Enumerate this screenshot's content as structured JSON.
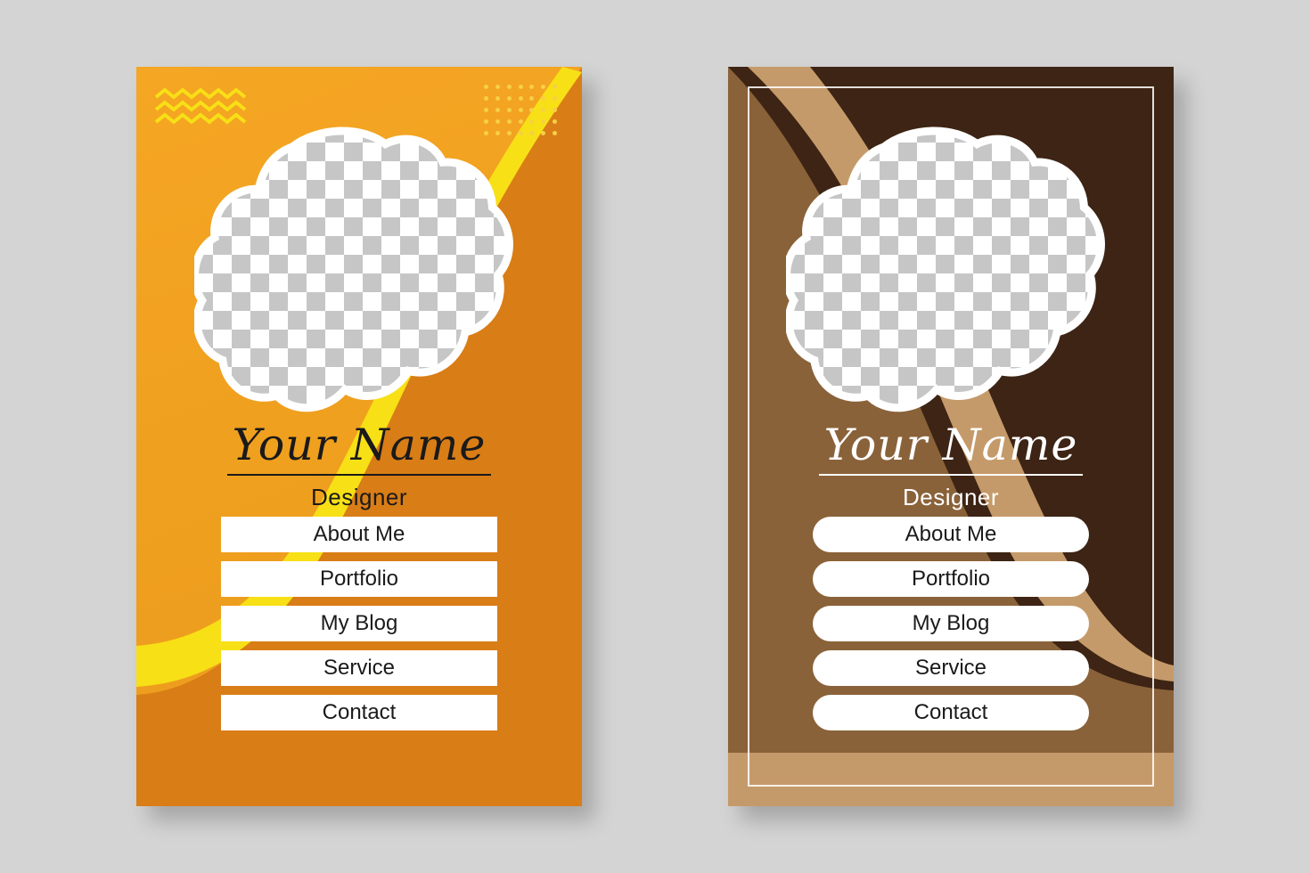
{
  "page": {
    "background_color": "#d4d4d4",
    "card_count": 2
  },
  "cards": [
    {
      "id": "card-orange",
      "theme": "orange",
      "colors": {
        "bg_light": "#f5a623",
        "bg_dark": "#d97d16",
        "accent_yellow": "#f7e016",
        "dots": "#f7d046",
        "text": "#1a1a1a",
        "button_bg": "#ffffff"
      },
      "decorations": [
        "zigzag-lines",
        "dot-grid",
        "yellow-wave",
        "dark-orange-curve"
      ],
      "photo": {
        "label": "photo-placeholder",
        "shape": "blob",
        "fill": "checkerboard"
      },
      "name": "Your Name",
      "role": "Designer",
      "buttons": [
        "About Me",
        "Portfolio",
        "My Blog",
        "Service",
        "Contact"
      ]
    },
    {
      "id": "card-brown",
      "theme": "brown",
      "colors": {
        "bg_dark": "#3d2414",
        "bg_mid": "#8a6239",
        "accent_tan": "#c59a6a",
        "frame_line": "#ffffff",
        "text": "#ffffff",
        "button_bg": "#ffffff"
      },
      "decorations": [
        "inner-border-frame",
        "tan-curve",
        "brown-curve"
      ],
      "photo": {
        "label": "photo-placeholder",
        "shape": "blob",
        "fill": "checkerboard"
      },
      "name": "Your Name",
      "role": "Designer",
      "buttons": [
        "About Me",
        "Portfolio",
        "My Blog",
        "Service",
        "Contact"
      ]
    }
  ]
}
